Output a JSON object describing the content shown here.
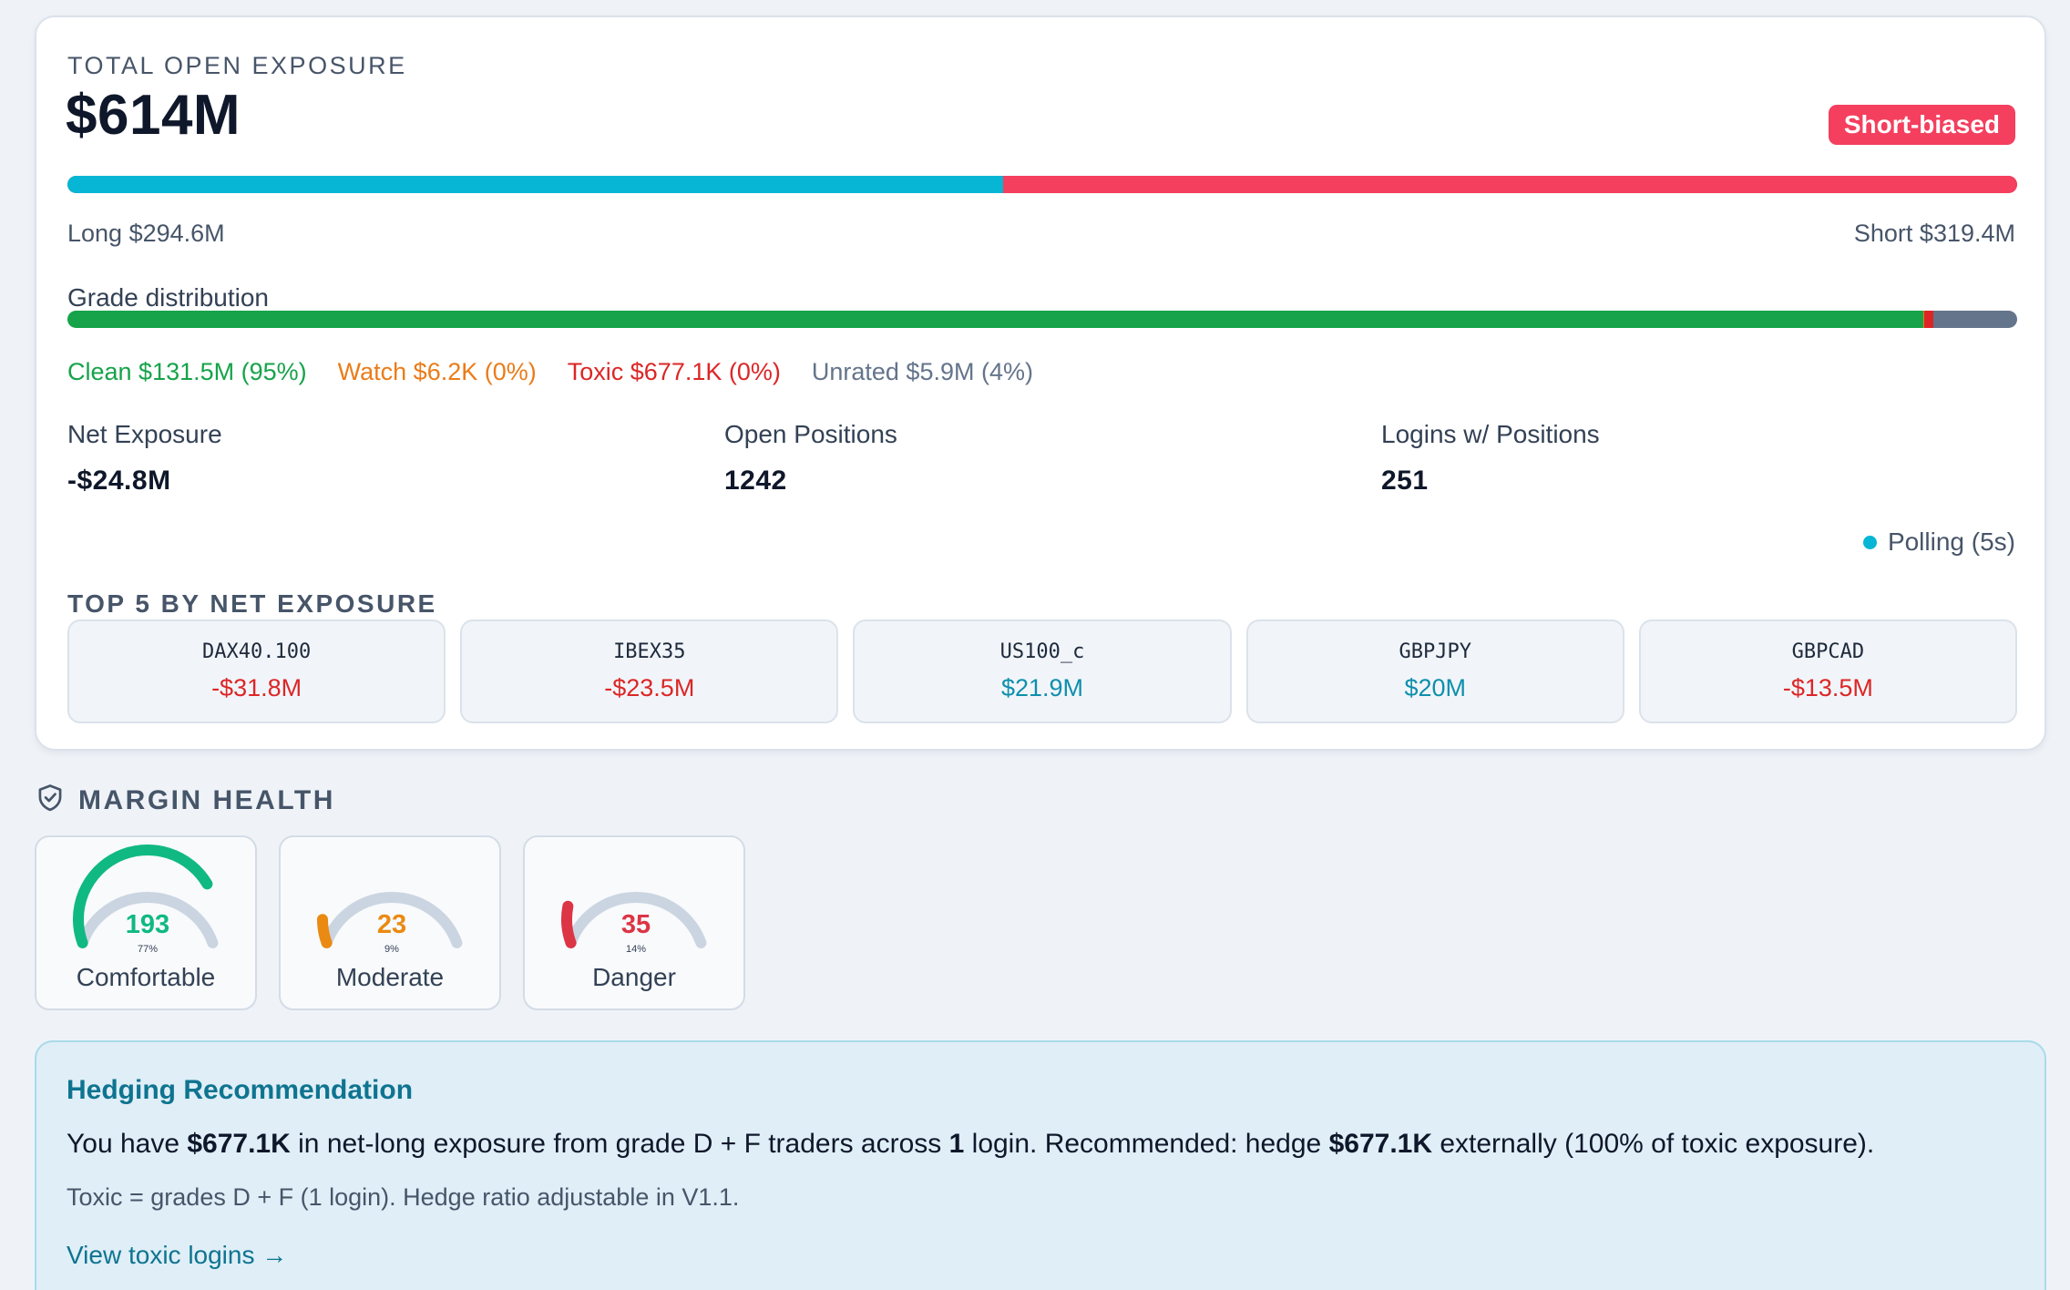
{
  "exposure": {
    "eyebrow": "TOTAL OPEN EXPOSURE",
    "total": "$614M",
    "bias_badge": "Short-biased",
    "long_label": "Long $294.6M",
    "short_label": "Short $319.4M",
    "long_fraction": 0.48,
    "colors": {
      "long": "#06b6d4",
      "short": "#f43f5e"
    }
  },
  "grades": {
    "title": "Grade distribution",
    "items": [
      {
        "label": "Clean $131.5M (95%)",
        "fraction": 0.952,
        "color": "#16a34a"
      },
      {
        "label": "Watch $6.2K (0%)",
        "fraction": 0.0005,
        "color": "#ea7c19"
      },
      {
        "label": "Toxic $677.1K (0%)",
        "fraction": 0.0045,
        "color": "#dc2626"
      },
      {
        "label": "Unrated $5.9M (4%)",
        "fraction": 0.043,
        "color": "#64748b"
      }
    ]
  },
  "stats": [
    {
      "label": "Net Exposure",
      "value": "-$24.8M"
    },
    {
      "label": "Open Positions",
      "value": "1242"
    },
    {
      "label": "Logins w/ Positions",
      "value": "251"
    }
  ],
  "polling": {
    "label": "Polling (5s)",
    "icon": "status-dot-icon",
    "color": "#06b6d4"
  },
  "top5": {
    "title": "TOP 5 BY NET EXPOSURE",
    "items": [
      {
        "symbol": "DAX40.100",
        "amount": "-$31.8M",
        "color": "#dc2626"
      },
      {
        "symbol": "IBEX35",
        "amount": "-$23.5M",
        "color": "#dc2626"
      },
      {
        "symbol": "US100_c",
        "amount": "$21.9M",
        "color": "#0e8fad"
      },
      {
        "symbol": "GBPJPY",
        "amount": "$20M",
        "color": "#0e8fad"
      },
      {
        "symbol": "GBPCAD",
        "amount": "-$13.5M",
        "color": "#dc2626"
      }
    ]
  },
  "margin": {
    "title": "MARGIN HEALTH",
    "icon": "shield-check-icon",
    "gauges": [
      {
        "count": "193",
        "pct": "77%",
        "fraction": 0.77,
        "label": "Comfortable",
        "color": "#10b981"
      },
      {
        "count": "23",
        "pct": "9%",
        "fraction": 0.09,
        "label": "Moderate",
        "color": "#ea8a12"
      },
      {
        "count": "35",
        "pct": "14%",
        "fraction": 0.14,
        "label": "Danger",
        "color": "#dc3545"
      }
    ]
  },
  "hedging": {
    "title": "Hedging Recommendation",
    "text_parts": [
      {
        "t": "You have ",
        "b": false
      },
      {
        "t": "$677.1K",
        "b": true
      },
      {
        "t": " in net-long exposure from grade D + F traders across ",
        "b": false
      },
      {
        "t": "1",
        "b": true
      },
      {
        "t": " login. Recommended: hedge ",
        "b": false
      },
      {
        "t": "$677.1K",
        "b": true
      },
      {
        "t": " externally (100% of toxic exposure).",
        "b": false
      }
    ],
    "note": "Toxic = grades D + F (1 login). Hedge ratio adjustable in V1.1.",
    "link": "View toxic logins →"
  }
}
